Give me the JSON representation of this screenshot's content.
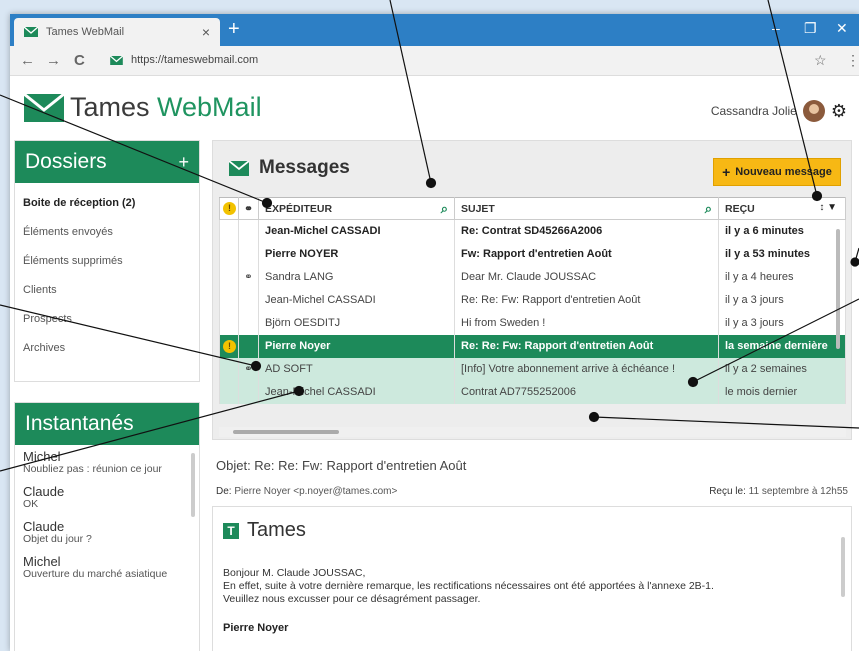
{
  "browser": {
    "tab_title": "Tames WebMail",
    "tab_close": "×",
    "new_tab": "+",
    "minimize": "–",
    "restore": "❐",
    "close": "✕",
    "back": "←",
    "forward": "→",
    "reload": "C",
    "url": "https://tameswebmail.com",
    "star": "☆",
    "menu": "⋮"
  },
  "app": {
    "brand_a": "Tames ",
    "brand_b": "WebMail",
    "user": "Cassandra Jolie",
    "gear": "⚙"
  },
  "sidebar": {
    "folders_title": "Dossiers",
    "add": "+",
    "folders": [
      {
        "label": "Boite de réception (2)",
        "active": true
      },
      {
        "label": "Éléments envoyés"
      },
      {
        "label": "Éléments supprimés"
      },
      {
        "label": "Clients"
      },
      {
        "label": "Prospects"
      },
      {
        "label": "Archives"
      }
    ],
    "snaps_title": "Instantanés",
    "snaps": [
      {
        "name": "Michel",
        "text": "Noubliez pas : réunion ce jour"
      },
      {
        "name": "Claude",
        "text": "OK"
      },
      {
        "name": "Claude",
        "text": "Objet du jour ?"
      },
      {
        "name": "Michel",
        "text": "Ouverture du marché asiatique"
      }
    ]
  },
  "messages": {
    "title": "Messages",
    "new_button": "Nouveau message",
    "new_plus": "+",
    "columns": {
      "sender": "EXPÉDITEUR",
      "subject": "SUJET",
      "received": "REÇU",
      "attach": "⚭",
      "sort": "↕ ▼"
    },
    "rows": [
      {
        "warn": false,
        "attach": false,
        "sender": "Jean-Michel CASSADI",
        "subject": "Re: Contrat SD45266A2006",
        "received": "il y a 6 minutes",
        "state": "unread"
      },
      {
        "warn": false,
        "attach": false,
        "sender": "Pierre NOYER",
        "subject": "Fw: Rapport d'entretien Août",
        "received": "il y a 53 minutes",
        "state": "unread"
      },
      {
        "warn": false,
        "attach": true,
        "sender": "Sandra LANG",
        "subject": "Dear Mr. Claude JOUSSAC",
        "received": "il y a 4 heures",
        "state": ""
      },
      {
        "warn": false,
        "attach": false,
        "sender": "Jean-Michel CASSADI",
        "subject": "Re: Re: Fw: Rapport d'entretien Août",
        "received": "il y a 3 jours",
        "state": ""
      },
      {
        "warn": false,
        "attach": false,
        "sender": "Björn OESDITJ",
        "subject": "Hi from Sweden !",
        "received": "il y a 3 jours",
        "state": ""
      },
      {
        "warn": true,
        "attach": false,
        "sender": "Pierre Noyer",
        "subject": "Re: Re: Fw: Rapport d'entretien Août",
        "received": "la semaine dernière",
        "state": "sel"
      },
      {
        "warn": false,
        "attach": true,
        "sender": "AD SOFT",
        "subject": "[Info] Votre abonnement arrive à échéance !",
        "received": "il y a 2 semaines",
        "state": "hl"
      },
      {
        "warn": false,
        "attach": false,
        "sender": "Jean-Michel CASSADI",
        "subject": "Contrat AD7755252006",
        "received": "le mois dernier",
        "state": "hl"
      }
    ]
  },
  "preview": {
    "objet_label": "Objet: ",
    "objet": "Re: Re: Fw: Rapport d'entretien Août",
    "from_label": "De: ",
    "from": "Pierre Noyer <p.noyer@tames.com>",
    "recu_label": "Reçu le: ",
    "recu": "11 septembre à 12h55",
    "logo": "Tames",
    "logo_mark": "T",
    "greeting": "Bonjour M. Claude JOUSSAC,",
    "line1": "En effet, suite à votre dernière remarque, les rectifications nécessaires ont été apportées à l'annexe 2B-1.",
    "line2": "Veuillez nous excusser pour ce désagrément passager.",
    "signature": "Pierre Noyer"
  },
  "colors": {
    "brand": "#1d8a5a",
    "accent": "#f7b814",
    "titlebar": "#2d7fc5"
  },
  "icons": [
    "envelope-icon",
    "search-icon",
    "attachment-icon",
    "warning-icon",
    "gear-icon",
    "avatar"
  ]
}
